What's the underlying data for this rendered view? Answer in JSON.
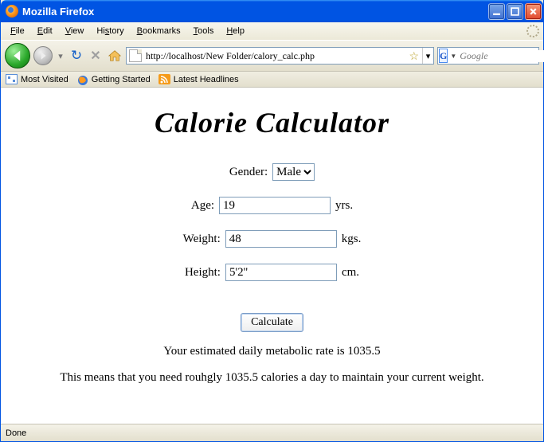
{
  "window": {
    "title": "Mozilla Firefox"
  },
  "menubar": {
    "items": [
      {
        "label": "File",
        "accel": "F"
      },
      {
        "label": "Edit",
        "accel": "E"
      },
      {
        "label": "View",
        "accel": "V"
      },
      {
        "label": "History",
        "accel": ""
      },
      {
        "label": "Bookmarks",
        "accel": "B"
      },
      {
        "label": "Tools",
        "accel": "T"
      },
      {
        "label": "Help",
        "accel": "H"
      }
    ]
  },
  "nav": {
    "url": "http://localhost/New Folder/calory_calc.php",
    "search_placeholder": "Google",
    "search_engine_letter": "G"
  },
  "bookmarks": {
    "items": [
      {
        "label": "Most Visited"
      },
      {
        "label": "Getting Started"
      },
      {
        "label": "Latest Headlines"
      }
    ]
  },
  "page": {
    "title": "Calorie Calculator",
    "gender_label": "Gender:",
    "gender_value": "Male",
    "age_label": "Age:",
    "age_value": "19",
    "age_unit": "yrs.",
    "weight_label": "Weight:",
    "weight_value": "48",
    "weight_unit": "kgs.",
    "height_label": "Height:",
    "height_value": "5'2''",
    "height_unit": "cm.",
    "calculate_label": "Calculate",
    "result1": "Your estimated daily metabolic rate is 1035.5",
    "result2": "This means that you need rouhgly 1035.5 calories a day to maintain your current weight."
  },
  "status": {
    "text": "Done"
  }
}
